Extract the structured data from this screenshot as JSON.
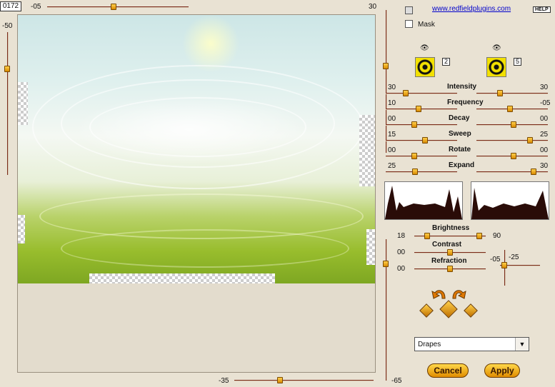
{
  "top": {
    "counter": "0172",
    "left_val": "-05",
    "right_val": "30",
    "left_knob_pct": 0.45
  },
  "left_slider": {
    "value": "-50",
    "knob_pct": 0.35
  },
  "bottom": {
    "left_val": "-35",
    "right_val": "-65",
    "knob_pct": 0.32
  },
  "mid_vertical": {
    "knob_pct": 0.18
  },
  "right_vertical": {
    "knob_pct": 0.5
  },
  "links": {
    "website": "www.redfieldplugins.com",
    "help": "HELP"
  },
  "mask": {
    "label": "Mask",
    "checked": false
  },
  "thumbs": {
    "left_num": "2",
    "right_num": "5",
    "left_eye": "👁",
    "right_eye": "👁"
  },
  "params": [
    {
      "name": "Intensity",
      "left": "30",
      "right": "30"
    },
    {
      "name": "Frequency",
      "left": "10",
      "right": "-05"
    },
    {
      "name": "Decay",
      "left": "00",
      "right": "00"
    },
    {
      "name": "Sweep",
      "left": "15",
      "right": "25"
    },
    {
      "name": "Rotate",
      "left": "00",
      "right": "00"
    },
    {
      "name": "Expand",
      "left": "25",
      "right": "30"
    }
  ],
  "brightness": {
    "label": "Brightness",
    "low": "18",
    "high": "90"
  },
  "contrast": {
    "label": "Contrast",
    "value": "00"
  },
  "refraction": {
    "label": "Refraction",
    "value": "00"
  },
  "extra": {
    "a": "-05",
    "b": "-25"
  },
  "preset": {
    "selected": "Drapes"
  },
  "buttons": {
    "cancel": "Cancel",
    "apply": "Apply"
  },
  "colors": {
    "accent": "#e08c00",
    "track": "#7a2a1a",
    "link": "#0000cc"
  },
  "icons": {
    "undo": "curved-arrow-left",
    "redo": "curved-arrow-right",
    "random": "dice"
  }
}
